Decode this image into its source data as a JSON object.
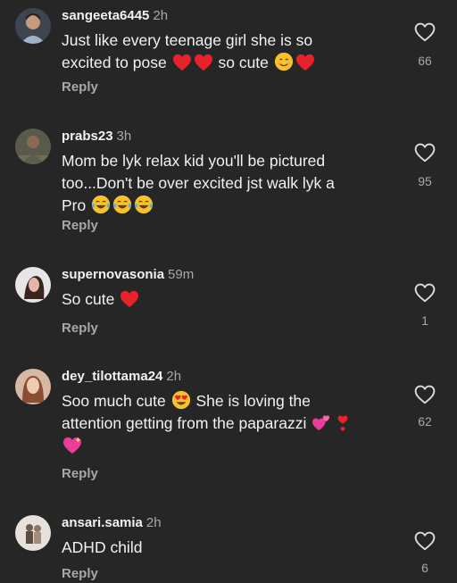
{
  "colors": {
    "background": "#262626",
    "primary_text": "#f2f2f2",
    "secondary_text": "#a8a8a8",
    "heart_red": "#e8222a",
    "emoji_yellow": "#f7c22a"
  },
  "comments": [
    {
      "username": "sangeeta6445",
      "time": "2h",
      "text_lines": [
        "Just like every teenage girl she is so",
        "excited to pose",
        "so cute"
      ],
      "like_count": "66",
      "reply_label": "Reply"
    },
    {
      "username": "prabs23",
      "time": "3h",
      "text_lines": [
        "Mom be lyk relax kid you'll be pictured",
        "too...Don't be over excited jst walk lyk a",
        "Pro"
      ],
      "like_count": "95",
      "reply_label": "Reply"
    },
    {
      "username": "supernovasonia",
      "time": "59m",
      "text_lines": [
        "So cute"
      ],
      "like_count": "1",
      "reply_label": "Reply"
    },
    {
      "username": "dey_tilottama24",
      "time": "2h",
      "text_lines": [
        "Soo much cute",
        "She is loving the",
        "attention getting from the paparazzi"
      ],
      "like_count": "62",
      "reply_label": "Reply"
    },
    {
      "username": "ansari.samia",
      "time": "2h",
      "text_lines": [
        "ADHD child"
      ],
      "like_count": "6",
      "reply_label": "Reply"
    }
  ]
}
